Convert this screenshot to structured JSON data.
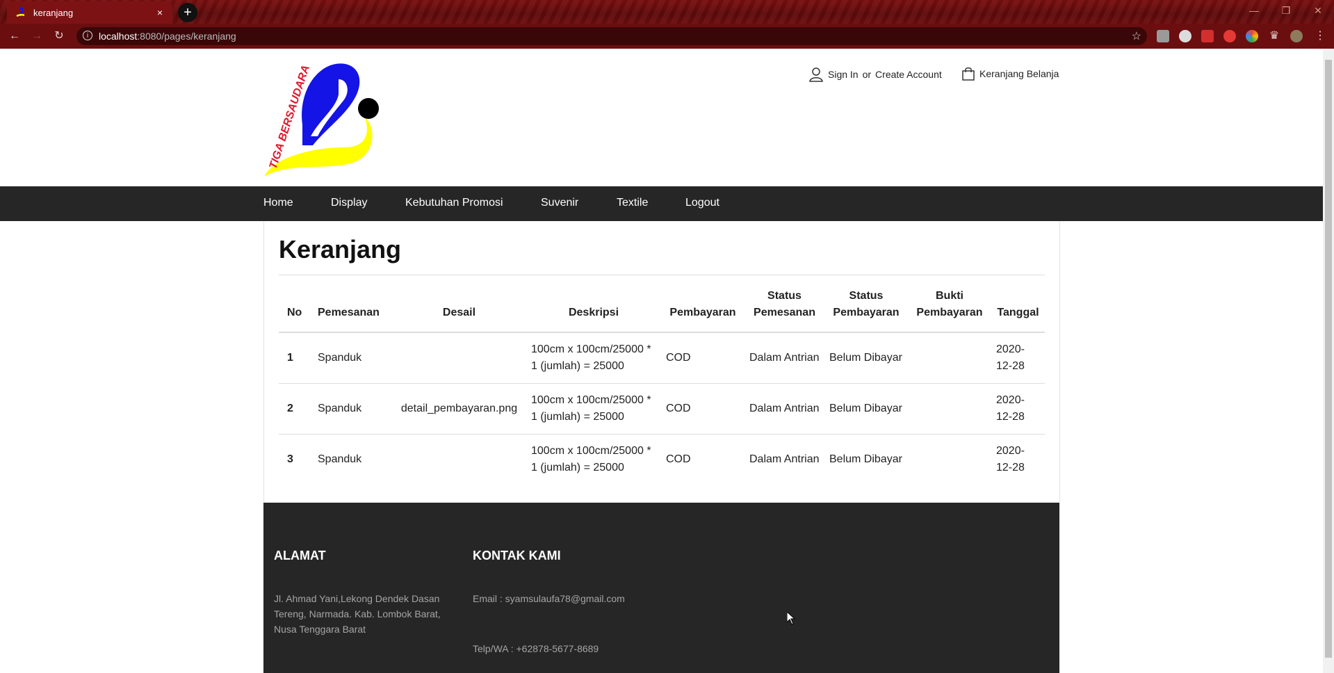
{
  "browser": {
    "tab_title": "keranjang",
    "tab_close": "×",
    "new_tab": "+",
    "url_host": "localhost",
    "url_rest": ":8080/pages/keranjang"
  },
  "header": {
    "account_signin": "Sign In",
    "account_or": "or",
    "account_create": "Create Account",
    "cart_label": "Keranjang Belanja",
    "logo_text": "TIGA BERSAUDARA"
  },
  "nav": {
    "items": [
      "Home",
      "Display",
      "Kebutuhan Promosi",
      "Suvenir",
      "Textile",
      "Logout"
    ]
  },
  "main": {
    "title": "Keranjang",
    "columns": [
      "No",
      "Pemesanan",
      "Desail",
      "Deskripsi",
      "Pembayaran",
      "Status Pemesanan",
      "Status Pembayaran",
      "Bukti Pembayaran",
      "Tanggal"
    ],
    "rows": [
      {
        "no": "1",
        "pemesanan": "Spanduk",
        "desain": "",
        "deskripsi": "100cm x 100cm/25000 * 1 (jumlah) = 25000",
        "pembayaran": "COD",
        "status_pemesanan": "Dalam Antrian",
        "status_pembayaran": "Belum Dibayar",
        "bukti": "",
        "tanggal": "2020-12-28"
      },
      {
        "no": "2",
        "pemesanan": "Spanduk",
        "desain": "detail_pembayaran.png",
        "deskripsi": "100cm x 100cm/25000 * 1 (jumlah) = 25000",
        "pembayaran": "COD",
        "status_pemesanan": "Dalam Antrian",
        "status_pembayaran": "Belum Dibayar",
        "bukti": "",
        "tanggal": "2020-12-28"
      },
      {
        "no": "3",
        "pemesanan": "Spanduk",
        "desain": "",
        "deskripsi": "100cm x 100cm/25000 * 1 (jumlah) = 25000",
        "pembayaran": "COD",
        "status_pemesanan": "Dalam Antrian",
        "status_pembayaran": "Belum Dibayar",
        "bukti": "",
        "tanggal": "2020-12-28"
      }
    ]
  },
  "footer": {
    "alamat_title": "ALAMAT",
    "alamat_text": "Jl. Ahmad Yani,Lekong Dendek Dasan Tereng, Narmada. Kab. Lombok Barat, Nusa Tenggara Barat",
    "kontak_title": "KONTAK KAMI",
    "email": "Email : syamsulaufa78@gmail.com",
    "telp": "Telp/WA : +62878-5677-8689"
  },
  "colors": {
    "navbar_bg": "#262626",
    "footer_bg": "#262626",
    "browser_frame": "#7a0f10",
    "logo_blue": "#1414e6",
    "logo_yellow": "#ffff00",
    "logo_red": "#e0182b"
  }
}
